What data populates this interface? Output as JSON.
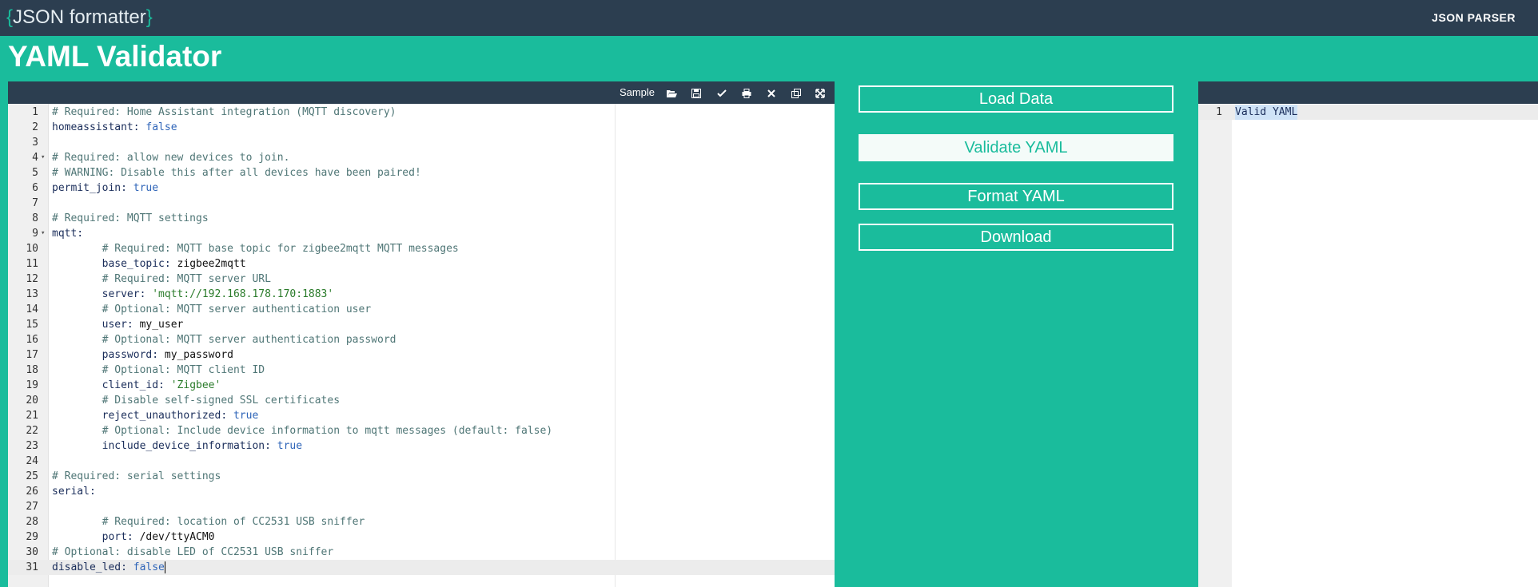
{
  "header": {
    "logo_open": "{",
    "logo_text": "JSON formatter",
    "logo_close": "}",
    "nav_link": "JSON PARSER"
  },
  "page_title": "YAML Validator",
  "editor": {
    "toolbar": {
      "sample_label": "Sample",
      "icons": [
        "folder-open-icon",
        "save-icon",
        "check-icon",
        "print-icon",
        "close-icon",
        "copy-icon",
        "fullscreen-icon"
      ]
    },
    "lines": [
      {
        "n": "1",
        "fold": false,
        "segments": [
          {
            "t": "# Required: Home Assistant integration (MQTT discovery)",
            "c": "cmt"
          }
        ]
      },
      {
        "n": "2",
        "fold": false,
        "segments": [
          {
            "t": "homeassistant: ",
            "c": "key"
          },
          {
            "t": "false",
            "c": "val"
          }
        ]
      },
      {
        "n": "3",
        "fold": false,
        "segments": []
      },
      {
        "n": "4",
        "fold": true,
        "segments": [
          {
            "t": "# Required: allow new devices to join.",
            "c": "cmt"
          }
        ]
      },
      {
        "n": "5",
        "fold": false,
        "segments": [
          {
            "t": "# WARNING: Disable this after all devices have been paired!",
            "c": "cmt"
          }
        ]
      },
      {
        "n": "6",
        "fold": false,
        "segments": [
          {
            "t": "permit_join: ",
            "c": "key"
          },
          {
            "t": "true",
            "c": "val"
          }
        ]
      },
      {
        "n": "7",
        "fold": false,
        "segments": []
      },
      {
        "n": "8",
        "fold": false,
        "segments": [
          {
            "t": "# Required: MQTT settings",
            "c": "cmt"
          }
        ]
      },
      {
        "n": "9",
        "fold": true,
        "segments": [
          {
            "t": "mqtt:",
            "c": "key"
          }
        ]
      },
      {
        "n": "10",
        "fold": false,
        "segments": [
          {
            "t": "        # Required: MQTT base topic for zigbee2mqtt MQTT messages",
            "c": "cmt"
          }
        ]
      },
      {
        "n": "11",
        "fold": false,
        "segments": [
          {
            "t": "        base_topic: ",
            "c": "key"
          },
          {
            "t": "zigbee2mqtt",
            "c": "plain"
          }
        ]
      },
      {
        "n": "12",
        "fold": false,
        "segments": [
          {
            "t": "        # Required: MQTT server URL",
            "c": "cmt"
          }
        ]
      },
      {
        "n": "13",
        "fold": false,
        "segments": [
          {
            "t": "        server: ",
            "c": "key"
          },
          {
            "t": "'mqtt://192.168.178.170:1883'",
            "c": "str"
          }
        ]
      },
      {
        "n": "14",
        "fold": false,
        "segments": [
          {
            "t": "        # Optional: MQTT server authentication user",
            "c": "cmt"
          }
        ]
      },
      {
        "n": "15",
        "fold": false,
        "segments": [
          {
            "t": "        user: ",
            "c": "key"
          },
          {
            "t": "my_user",
            "c": "plain"
          }
        ]
      },
      {
        "n": "16",
        "fold": false,
        "segments": [
          {
            "t": "        # Optional: MQTT server authentication password",
            "c": "cmt"
          }
        ]
      },
      {
        "n": "17",
        "fold": false,
        "segments": [
          {
            "t": "        password: ",
            "c": "key"
          },
          {
            "t": "my_password",
            "c": "plain"
          }
        ]
      },
      {
        "n": "18",
        "fold": false,
        "segments": [
          {
            "t": "        # Optional: MQTT client ID",
            "c": "cmt"
          }
        ]
      },
      {
        "n": "19",
        "fold": false,
        "segments": [
          {
            "t": "        client_id: ",
            "c": "key"
          },
          {
            "t": "'Zigbee'",
            "c": "str"
          }
        ]
      },
      {
        "n": "20",
        "fold": false,
        "segments": [
          {
            "t": "        # Disable self-signed SSL certificates",
            "c": "cmt"
          }
        ]
      },
      {
        "n": "21",
        "fold": false,
        "segments": [
          {
            "t": "        reject_unauthorized: ",
            "c": "key"
          },
          {
            "t": "true",
            "c": "val"
          }
        ]
      },
      {
        "n": "22",
        "fold": false,
        "segments": [
          {
            "t": "        # Optional: Include device information to mqtt messages (default: false)",
            "c": "cmt"
          }
        ]
      },
      {
        "n": "23",
        "fold": false,
        "segments": [
          {
            "t": "        include_device_information: ",
            "c": "key"
          },
          {
            "t": "true",
            "c": "val"
          }
        ]
      },
      {
        "n": "24",
        "fold": false,
        "segments": []
      },
      {
        "n": "25",
        "fold": false,
        "segments": [
          {
            "t": "# Required: serial settings",
            "c": "cmt"
          }
        ]
      },
      {
        "n": "26",
        "fold": false,
        "segments": [
          {
            "t": "serial:",
            "c": "key"
          }
        ]
      },
      {
        "n": "27",
        "fold": false,
        "segments": []
      },
      {
        "n": "28",
        "fold": false,
        "segments": [
          {
            "t": "        # Required: location of CC2531 USB sniffer",
            "c": "cmt"
          }
        ]
      },
      {
        "n": "29",
        "fold": false,
        "segments": [
          {
            "t": "        port: ",
            "c": "key"
          },
          {
            "t": "/dev/ttyACM0",
            "c": "plain"
          }
        ]
      },
      {
        "n": "30",
        "fold": false,
        "segments": [
          {
            "t": "# Optional: disable LED of CC2531 USB sniffer",
            "c": "cmt"
          }
        ]
      },
      {
        "n": "31",
        "fold": false,
        "active": true,
        "segments": [
          {
            "t": "disable_led: ",
            "c": "key"
          },
          {
            "t": "false",
            "c": "val"
          }
        ]
      }
    ]
  },
  "actions": {
    "load_label": "Load Data",
    "validate_label": "Validate YAML",
    "format_label": "Format YAML",
    "download_label": "Download"
  },
  "output": {
    "line_number": "1",
    "text": "Valid YAML"
  },
  "colors": {
    "brand": "#1abc9c",
    "header": "#2c3e50"
  }
}
